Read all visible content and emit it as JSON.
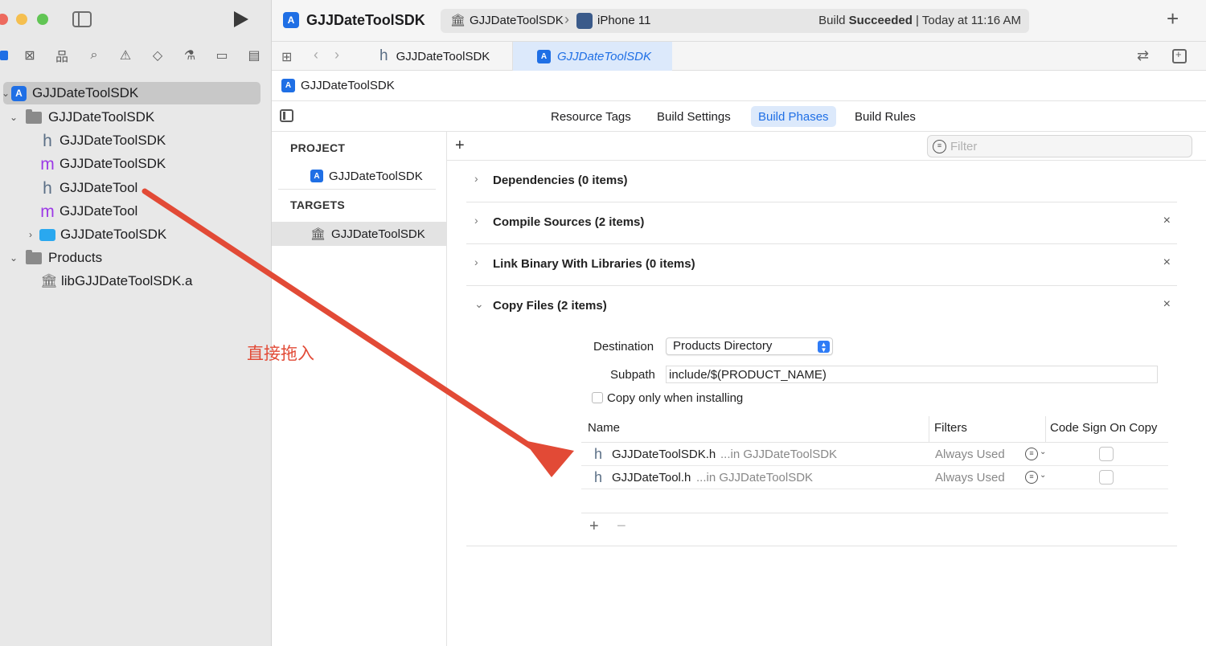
{
  "sidebar": {
    "tree": [
      {
        "label": "GJJDateToolSDK",
        "kind": "project"
      },
      {
        "label": "GJJDateToolSDK",
        "kind": "folder"
      },
      {
        "label": "GJJDateToolSDK",
        "kind": "h"
      },
      {
        "label": "GJJDateToolSDK",
        "kind": "m"
      },
      {
        "label": "GJJDateTool",
        "kind": "h"
      },
      {
        "label": "GJJDateTool",
        "kind": "m"
      },
      {
        "label": "GJJDateToolSDK",
        "kind": "target"
      },
      {
        "label": "Products",
        "kind": "folder"
      },
      {
        "label": "libGJJDateToolSDK.a",
        "kind": "library"
      }
    ]
  },
  "toolbar": {
    "project_title": "GJJDateToolSDK",
    "scheme": "GJJDateToolSDK",
    "device": "iPhone 11",
    "build_status_prefix": "Build ",
    "build_status_bold": "Succeeded",
    "build_status_suffix": " | Today at 11:16 AM"
  },
  "tabs": {
    "tab1": "GJJDateToolSDK",
    "tab2": "GJJDateToolSDK"
  },
  "jumpbar": {
    "label": "GJJDateToolSDK"
  },
  "settings_tabs": {
    "resource_tags": "Resource Tags",
    "build_settings": "Build Settings",
    "build_phases": "Build Phases",
    "build_rules": "Build Rules"
  },
  "targets_panel": {
    "project_header": "PROJECT",
    "project_item": "GJJDateToolSDK",
    "targets_header": "TARGETS",
    "target_item": "GJJDateToolSDK"
  },
  "phases": {
    "filter_placeholder": "Filter",
    "list": [
      "Dependencies (0 items)",
      "Compile Sources (2 items)",
      "Link Binary With Libraries (0 items)",
      "Copy Files (2 items)"
    ],
    "copy_files": {
      "destination_label": "Destination",
      "destination_value": "Products Directory",
      "subpath_label": "Subpath",
      "subpath_value": "include/$(PRODUCT_NAME)",
      "install_label": "Copy only when installing",
      "columns": {
        "name": "Name",
        "filters": "Filters",
        "code_sign": "Code Sign On Copy"
      },
      "rows": [
        {
          "name": "GJJDateToolSDK.h",
          "location": "...in GJJDateToolSDK",
          "filters": "Always Used"
        },
        {
          "name": "GJJDateTool.h",
          "location": "...in GJJDateToolSDK",
          "filters": "Always Used"
        }
      ]
    }
  },
  "annotation": {
    "text": "直接拖入",
    "color": "#e24a36"
  },
  "colors": {
    "accent": "#1f6fe5",
    "selection": "#dce9fb"
  }
}
